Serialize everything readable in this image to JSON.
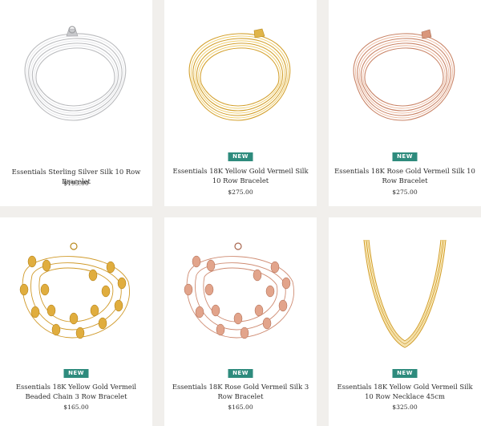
{
  "products": [
    {
      "name": "Essentials Sterling Silver Silk 10 Row Bracelet",
      "price": "$195.00",
      "badge": "",
      "image": "silver-silk-bracelet-image",
      "colors": {
        "metal": "#b9babd",
        "light": "#e6e7ea"
      }
    },
    {
      "name": "Essentials 18K Yellow Gold Vermeil Silk 10 Row Bracelet",
      "price": "$275.00",
      "badge": "NEW",
      "image": "yellow-gold-silk-bracelet-image",
      "colors": {
        "metal": "#d4a12e",
        "light": "#f0cf6e"
      }
    },
    {
      "name": "Essentials 18K Rose Gold Vermeil Silk 10 Row Bracelet",
      "price": "$275.00",
      "badge": "NEW",
      "image": "rose-gold-silk-bracelet-image",
      "colors": {
        "metal": "#c98467",
        "light": "#ecb99e"
      }
    },
    {
      "name": "Essentials 18K Yellow Gold Vermeil Beaded Chain 3 Row Bracelet",
      "price": "$165.00",
      "badge": "NEW",
      "image": "yellow-gold-beaded-bracelet-image",
      "colors": {
        "metal": "#d09a2a",
        "light": "#f1cf75"
      }
    },
    {
      "name": "Essentials 18K Rose Gold Vermeil Silk 3 Row Bracelet",
      "price": "$165.00",
      "badge": "NEW",
      "image": "rose-gold-beaded-bracelet-image",
      "colors": {
        "metal": "#cf8c73",
        "light": "#f1c2ab"
      }
    },
    {
      "name": "Essentials 18K Yellow Gold Vermeil Silk 10 Row Necklace 45cm",
      "price": "$325.00",
      "badge": "NEW",
      "image": "yellow-gold-silk-necklace-image",
      "colors": {
        "metal": "#d4a12e",
        "light": "#f0cf6e"
      }
    }
  ],
  "badge_color": "#2e8b7d",
  "background_color": "#f1efec"
}
